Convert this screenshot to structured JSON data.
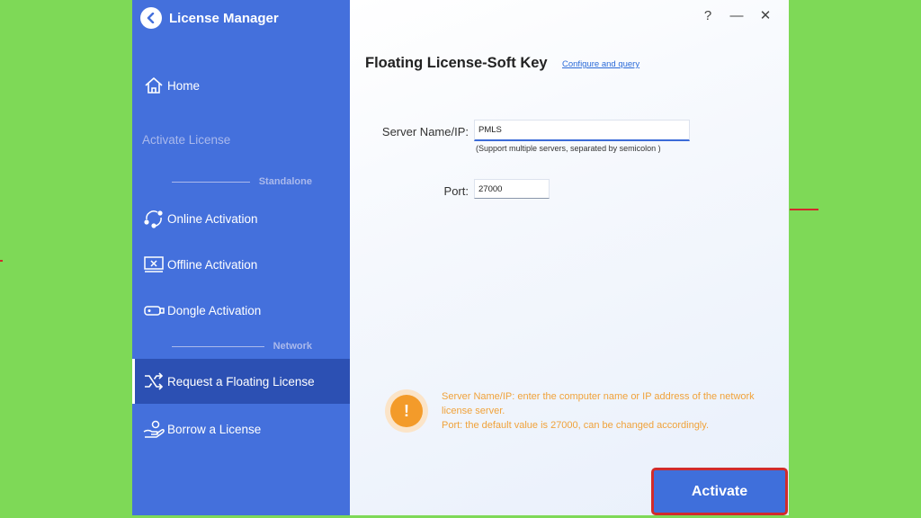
{
  "app": {
    "title": "License Manager"
  },
  "sidebar": {
    "home": "Home",
    "activate_license": "Activate License",
    "section_standalone": "Standalone",
    "online_activation": "Online Activation",
    "offline_activation": "Offline Activation",
    "dongle_activation": "Dongle Activation",
    "section_network": "Network",
    "request_floating": "Request a Floating License",
    "borrow_license": "Borrow a License"
  },
  "window_controls": {
    "help": "?",
    "minimize": "—",
    "close": "✕"
  },
  "main": {
    "title": "Floating License-Soft Key",
    "configure_link": "Configure and query",
    "server_label": "Server Name/IP:",
    "server_value": "PMLS",
    "server_hint": "(Support multiple servers, separated by semicolon )",
    "port_label": "Port:",
    "port_value": "27000",
    "info_icon": "!",
    "info_line1": "Server Name/IP: enter the computer name or IP address of the network license server.",
    "info_line2": "Port: the default value is 27000, can be changed accordingly.",
    "activate": "Activate"
  },
  "icons": {
    "back": "chevron-left-icon",
    "home": "home-icon",
    "online": "network-nodes-icon",
    "offline": "monitor-x-icon",
    "dongle": "usb-dongle-icon",
    "floating": "shuffle-icon",
    "borrow": "hand-icon"
  },
  "colors": {
    "sidebar": "#4470dc",
    "sidebar_active": "#2c50b3",
    "accent": "#3f6fdb",
    "warning": "#f39b2a",
    "highlight": "#d12b2b",
    "background": "#7ed957"
  }
}
